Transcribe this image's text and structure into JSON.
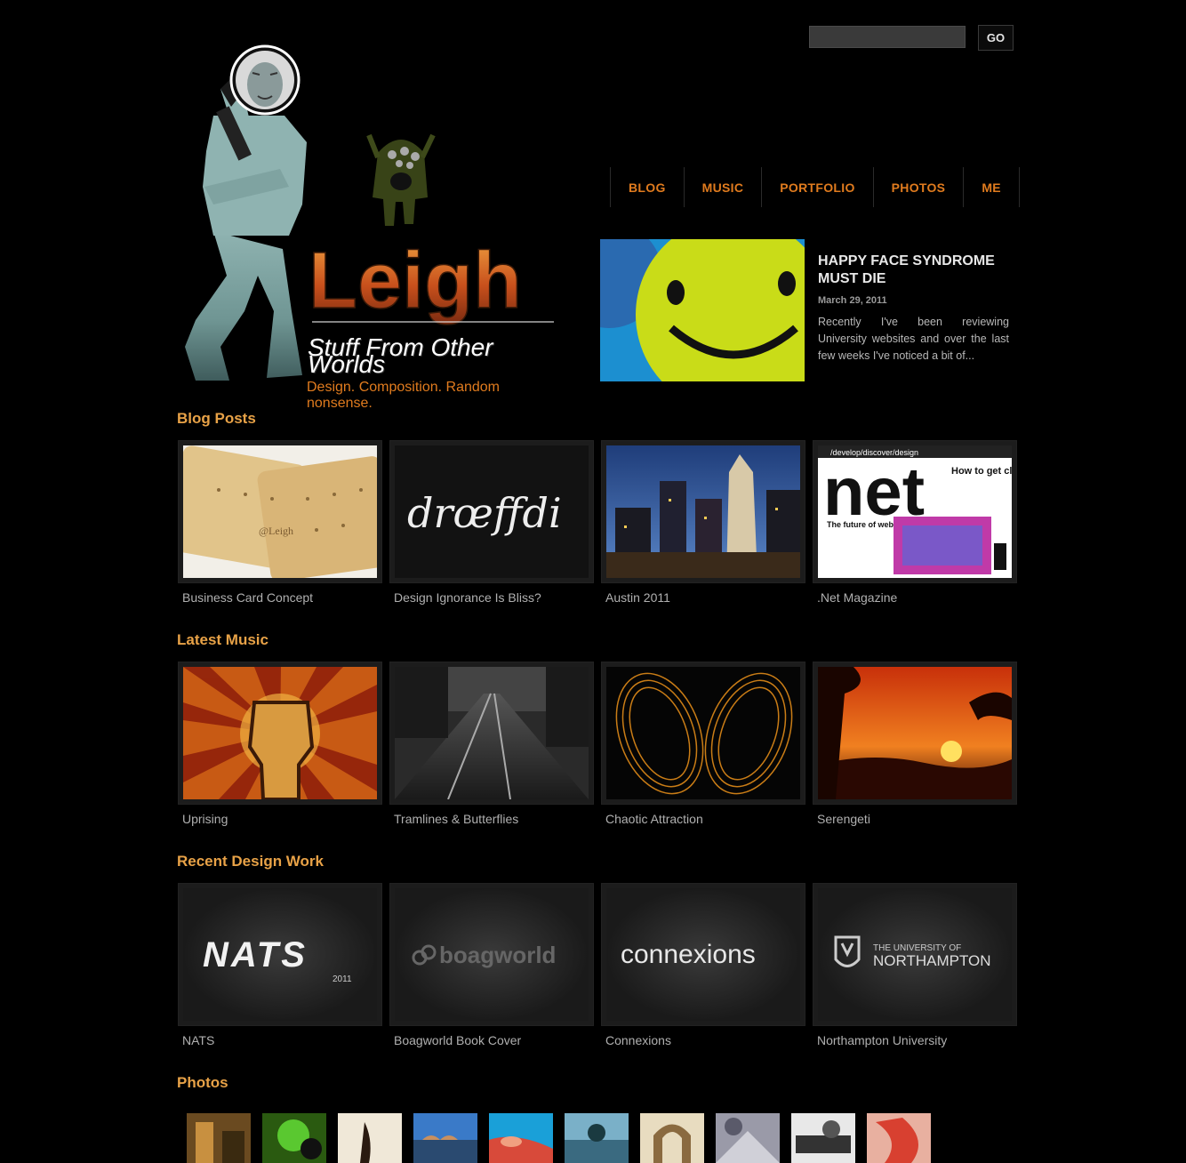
{
  "search": {
    "placeholder": "",
    "button_label": "GO"
  },
  "nav": [
    {
      "label": "BLOG"
    },
    {
      "label": "MUSIC"
    },
    {
      "label": "PORTFOLIO"
    },
    {
      "label": "PHOTOS"
    },
    {
      "label": "ME"
    }
  ],
  "brand": {
    "logo_text": "Leigh",
    "tagline": "Stuff From Other Worlds",
    "subtagline": "Design. Composition. Random nonsense."
  },
  "featured": {
    "title": "HAPPY FACE SYNDROME MUST DIE",
    "date": "March 29, 2011",
    "excerpt": "Recently I've been reviewing University websites and over the last few weeks I've noticed a bit of..."
  },
  "sections": {
    "blog": {
      "title": "Blog Posts",
      "items": [
        {
          "caption": "Business Card Concept",
          "image": "crackers-photo"
        },
        {
          "caption": "Design Ignorance Is Bliss?",
          "image": "script-typography"
        },
        {
          "caption": "Austin 2011",
          "image": "city-night-photo"
        },
        {
          "caption": ".Net Magazine",
          "image": "magazine-cover"
        }
      ]
    },
    "music": {
      "title": "Latest Music",
      "items": [
        {
          "caption": "Uprising",
          "image": "raised-fist-art"
        },
        {
          "caption": "Tramlines & Butterflies",
          "image": "rainy-street-photo"
        },
        {
          "caption": "Chaotic Attraction",
          "image": "orange-light-trails"
        },
        {
          "caption": "Serengeti",
          "image": "savanna-sunset"
        }
      ]
    },
    "design": {
      "title": "Recent Design Work",
      "items": [
        {
          "caption": "NATS",
          "image": "nats-logo"
        },
        {
          "caption": "Boagworld Book Cover",
          "image": "boagworld-logo"
        },
        {
          "caption": "Connexions",
          "image": "connexions-logo"
        },
        {
          "caption": "Northampton University",
          "image": "northampton-logo"
        }
      ]
    },
    "photos": {
      "title": "Photos"
    }
  },
  "logo_texts": {
    "net": "net",
    "net_tagline": "How to get clients on side",
    "net_header": "/develop/discover/design",
    "net_feature": "The future of web app stores",
    "nats": "NATS",
    "nats_year": "2011",
    "boagworld": "boagworld",
    "connexions": "connexions",
    "northampton_line1": "THE UNIVERSITY OF",
    "northampton_line2": "NORTHAMPTON",
    "script": "drœffdi",
    "card_text": "@Leigh"
  },
  "colors": {
    "accent": "#e07b1e",
    "heading": "#e8a247",
    "background": "#000000"
  }
}
